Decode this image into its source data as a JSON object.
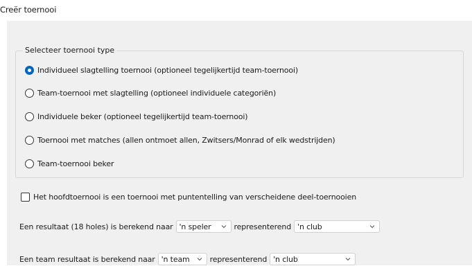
{
  "window": {
    "title": "Creër toernooi"
  },
  "tournament_type": {
    "legend": "Selecteer toernooi type",
    "options": [
      {
        "label": "Individueel slagtelling toernooi (optioneel tegelijkertijd team-toernooi)",
        "selected": true
      },
      {
        "label": "Team-toernooi met slagtelling (optioneel individuele categoriën)",
        "selected": false
      },
      {
        "label": "Individuele beker (optioneel tegelijkertijd team-toernooi)",
        "selected": false
      },
      {
        "label": "Toernooi met matches (allen ontmoet allen, Zwitsers/Monrad of elk wedstrijden)",
        "selected": false
      },
      {
        "label": "Team-toernooi beker",
        "selected": false
      }
    ]
  },
  "main_tournament_checkbox": {
    "label": "Het hoofdtoernooi is een toernooi met puntentelling van verscheidene deel-toernooien",
    "checked": false
  },
  "result_line": {
    "prefix": "Een resultaat (18 holes) is berekend naar",
    "select1_value": "'n speler",
    "middle": "representerend",
    "select2_value": "'n club"
  },
  "team_line": {
    "prefix": "Een team resultaat is berekend naar",
    "select1_value": "'n team",
    "middle": "representerend",
    "select2_value": "'n club"
  },
  "icons": {
    "radio_selected_color": "#0067c0",
    "dropdown_chevron": "chevron-down-icon"
  }
}
